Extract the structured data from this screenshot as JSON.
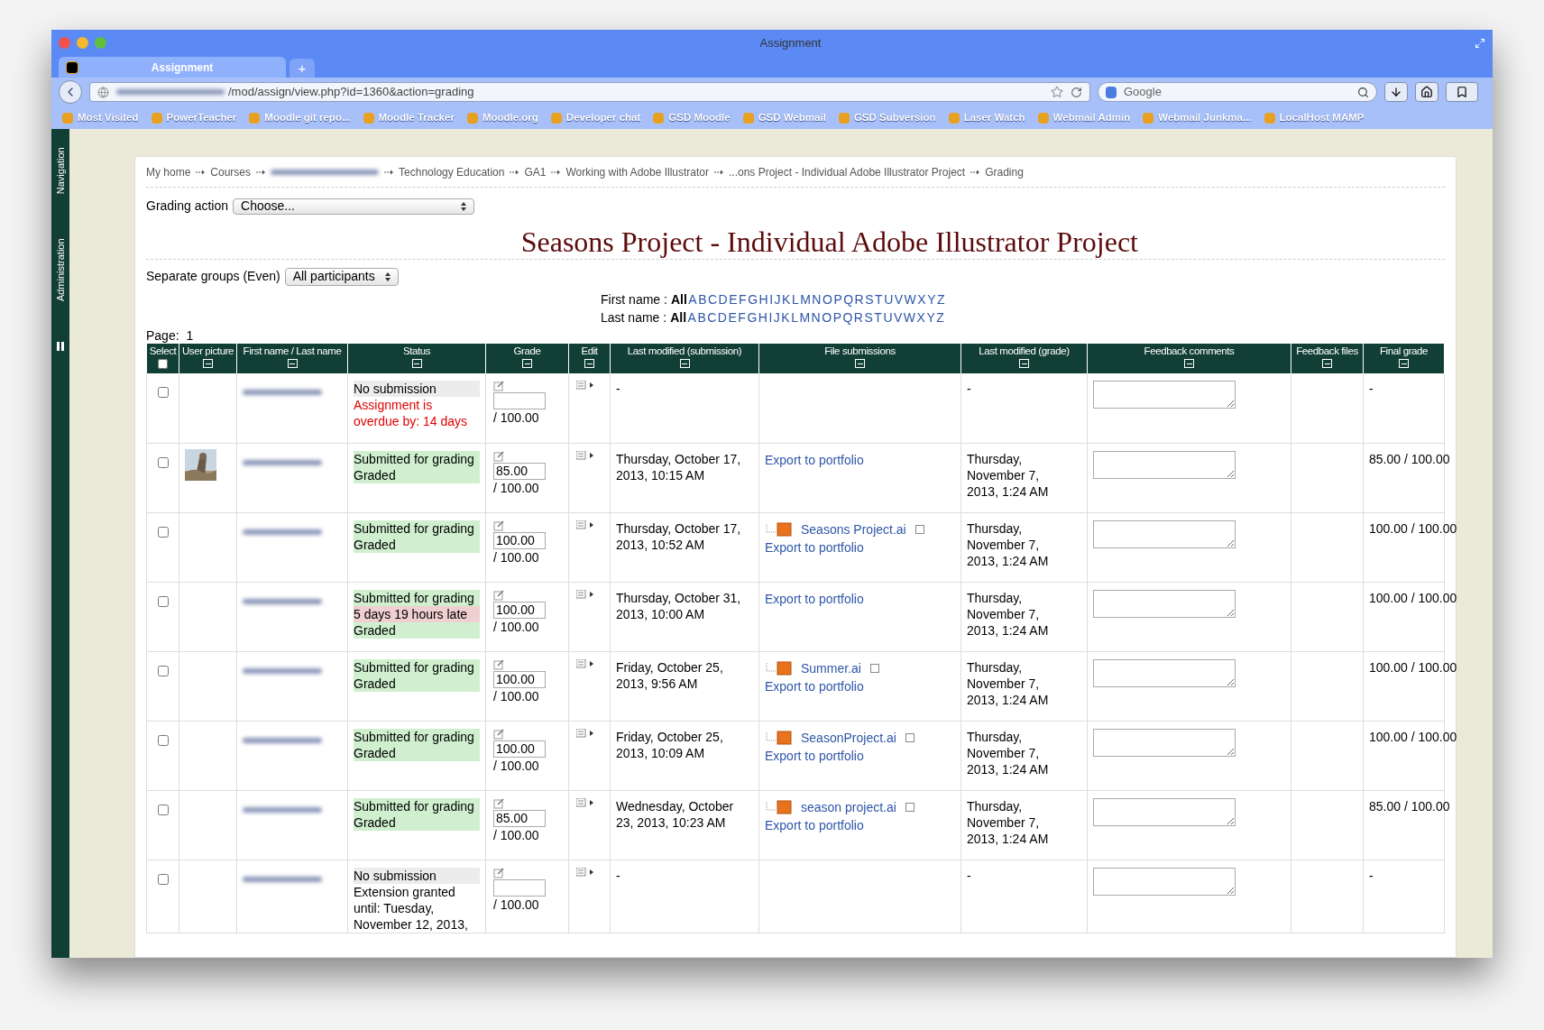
{
  "window": {
    "title": "Assignment"
  },
  "tabs": [
    {
      "label": "Assignment",
      "selected": true
    }
  ],
  "new_tab": "+",
  "address_bar": {
    "url": "/mod/assign/view.php?id=1360&action=grading"
  },
  "search": {
    "placeholder": "Google"
  },
  "bookmarks": [
    "Most Visited",
    "PowerTeacher",
    "Moodle git repo...",
    "Moodle Tracker",
    "Moodle.org",
    "Developer chat",
    "GSD Moodle",
    "GSD Webmail",
    "GSD Subversion",
    "Laser Watch",
    "Webmail Admin",
    "Webmail Junkma...",
    "LocalHost MAMP"
  ],
  "side_tabs": [
    "Navigation",
    "Administration"
  ],
  "breadcrumb": [
    {
      "kind": "link",
      "label": "My home"
    },
    {
      "kind": "link",
      "label": "Courses"
    },
    {
      "kind": "blurred"
    },
    {
      "kind": "link",
      "label": "Technology Education"
    },
    {
      "kind": "link",
      "label": "GA1"
    },
    {
      "kind": "link",
      "label": "Working with Adobe Illustrator"
    },
    {
      "kind": "link",
      "label": "...ons Project - Individual Adobe Illustrator Project"
    },
    {
      "kind": "link",
      "label": "Grading"
    }
  ],
  "grading_action": {
    "label": "Grading action",
    "value": "Choose..."
  },
  "title": "Seasons Project - Individual Adobe Illustrator Project",
  "groups": {
    "label": "Separate groups (Even)",
    "value": "All participants"
  },
  "initials": [
    {
      "label": "First name :",
      "letters": [
        {
          "label": "All",
          "selected": true
        },
        {
          "label": "A",
          "selected": false
        },
        {
          "label": "B",
          "selected": false
        },
        {
          "label": "C",
          "selected": false
        },
        {
          "label": "D",
          "selected": false
        },
        {
          "label": "E",
          "selected": false
        },
        {
          "label": "F",
          "selected": false
        },
        {
          "label": "G",
          "selected": false
        },
        {
          "label": "H",
          "selected": false
        },
        {
          "label": "I",
          "selected": false
        },
        {
          "label": "J",
          "selected": false
        },
        {
          "label": "K",
          "selected": false
        },
        {
          "label": "L",
          "selected": false
        },
        {
          "label": "M",
          "selected": false
        },
        {
          "label": "N",
          "selected": false
        },
        {
          "label": "O",
          "selected": false
        },
        {
          "label": "P",
          "selected": false
        },
        {
          "label": "Q",
          "selected": false
        },
        {
          "label": "R",
          "selected": false
        },
        {
          "label": "S",
          "selected": false
        },
        {
          "label": "T",
          "selected": false
        },
        {
          "label": "U",
          "selected": false
        },
        {
          "label": "V",
          "selected": false
        },
        {
          "label": "W",
          "selected": false
        },
        {
          "label": "X",
          "selected": false
        },
        {
          "label": "Y",
          "selected": false
        },
        {
          "label": "Z",
          "selected": false
        }
      ]
    },
    {
      "label": "Last name :",
      "letters": [
        {
          "label": "All",
          "selected": true
        },
        {
          "label": "A",
          "selected": false
        },
        {
          "label": "B",
          "selected": false
        },
        {
          "label": "C",
          "selected": false
        },
        {
          "label": "D",
          "selected": false
        },
        {
          "label": "E",
          "selected": false
        },
        {
          "label": "F",
          "selected": false
        },
        {
          "label": "G",
          "selected": false
        },
        {
          "label": "H",
          "selected": false
        },
        {
          "label": "I",
          "selected": false
        },
        {
          "label": "J",
          "selected": false
        },
        {
          "label": "K",
          "selected": false
        },
        {
          "label": "L",
          "selected": false
        },
        {
          "label": "M",
          "selected": false
        },
        {
          "label": "N",
          "selected": false
        },
        {
          "label": "O",
          "selected": false
        },
        {
          "label": "P",
          "selected": false
        },
        {
          "label": "Q",
          "selected": false
        },
        {
          "label": "R",
          "selected": false
        },
        {
          "label": "S",
          "selected": false
        },
        {
          "label": "T",
          "selected": false
        },
        {
          "label": "U",
          "selected": false
        },
        {
          "label": "V",
          "selected": false
        },
        {
          "label": "W",
          "selected": false
        },
        {
          "label": "X",
          "selected": false
        },
        {
          "label": "Y",
          "selected": false
        },
        {
          "label": "Z",
          "selected": false
        }
      ]
    }
  ],
  "page": {
    "label": "Page:",
    "number": "1"
  },
  "table": {
    "select_all_checked": false,
    "columns": [
      {
        "label": "Select",
        "kind": "checkbox"
      },
      {
        "label": "User picture",
        "kind": "collapse"
      },
      {
        "label": "First name / Last name",
        "kind": "collapse"
      },
      {
        "label": "Status",
        "kind": "collapse"
      },
      {
        "label": "Grade",
        "kind": "collapse"
      },
      {
        "label": "Edit",
        "kind": "collapse"
      },
      {
        "label": "Last modified (submission)",
        "kind": "collapse"
      },
      {
        "label": "File submissions",
        "kind": "collapse"
      },
      {
        "label": "Last modified (grade)",
        "kind": "collapse"
      },
      {
        "label": "Feedback comments",
        "kind": "collapse"
      },
      {
        "label": "Feedback files",
        "kind": "collapse"
      },
      {
        "label": "Final grade",
        "kind": "collapse"
      }
    ],
    "rows": [
      {
        "checked": false,
        "has_picture": false,
        "status": [
          {
            "text": "No submission",
            "kind": "neutral"
          },
          {
            "text": "Assignment is overdue by: 14 days",
            "kind": "alert"
          }
        ],
        "grade_max": "/ 100.00",
        "last_modified_submission": "-",
        "files": [],
        "last_modified_grade": "-",
        "final_grade": "-"
      },
      {
        "checked": false,
        "has_picture": true,
        "status": [
          {
            "text": "Submitted for grading",
            "kind": "ok"
          },
          {
            "text": "Graded",
            "kind": "ok"
          }
        ],
        "grade": "85.00",
        "grade_max": "/ 100.00",
        "last_modified_submission": "Thursday, October 17, 2013, 10:15 AM",
        "files": [],
        "export": "Export to portfolio",
        "last_modified_grade": "Thursday, November 7, 2013, 1:24 AM",
        "final_grade": "85.00 / 100.00"
      },
      {
        "checked": false,
        "has_picture": false,
        "status": [
          {
            "text": "Submitted for grading",
            "kind": "ok"
          },
          {
            "text": "Graded",
            "kind": "ok"
          }
        ],
        "grade": "100.00",
        "grade_max": "/ 100.00",
        "last_modified_submission": "Thursday, October 17, 2013, 10:52 AM",
        "files": [
          "Seasons Project.ai"
        ],
        "export": "Export to portfolio",
        "last_modified_grade": "Thursday, November 7, 2013, 1:24 AM",
        "final_grade": "100.00 / 100.00"
      },
      {
        "checked": false,
        "has_picture": false,
        "status": [
          {
            "text": "Submitted for grading",
            "kind": "ok"
          },
          {
            "text": "5 days 19 hours late",
            "kind": "late"
          },
          {
            "text": "Graded",
            "kind": "ok"
          }
        ],
        "grade": "100.00",
        "grade_max": "/ 100.00",
        "last_modified_submission": "Thursday, October 31, 2013, 10:00 AM",
        "files": [],
        "export": "Export to portfolio",
        "last_modified_grade": "Thursday, November 7, 2013, 1:24 AM",
        "final_grade": "100.00 / 100.00"
      },
      {
        "checked": false,
        "has_picture": false,
        "status": [
          {
            "text": "Submitted for grading",
            "kind": "ok"
          },
          {
            "text": "Graded",
            "kind": "ok"
          }
        ],
        "grade": "100.00",
        "grade_max": "/ 100.00",
        "last_modified_submission": "Friday, October 25, 2013, 9:56 AM",
        "files": [
          "Summer.ai"
        ],
        "export": "Export to portfolio",
        "last_modified_grade": "Thursday, November 7, 2013, 1:24 AM",
        "final_grade": "100.00 / 100.00"
      },
      {
        "checked": false,
        "has_picture": false,
        "status": [
          {
            "text": "Submitted for grading",
            "kind": "ok"
          },
          {
            "text": "Graded",
            "kind": "ok"
          }
        ],
        "grade": "100.00",
        "grade_max": "/ 100.00",
        "last_modified_submission": "Friday, October 25, 2013, 10:09 AM",
        "files": [
          "SeasonProject.ai"
        ],
        "export": "Export to portfolio",
        "last_modified_grade": "Thursday, November 7, 2013, 1:24 AM",
        "final_grade": "100.00 / 100.00"
      },
      {
        "checked": false,
        "has_picture": false,
        "status": [
          {
            "text": "Submitted for grading",
            "kind": "ok"
          },
          {
            "text": "Graded",
            "kind": "ok"
          }
        ],
        "grade": "85.00",
        "grade_max": "/ 100.00",
        "last_modified_submission": "Wednesday, October 23, 2013, 10:23 AM",
        "files": [
          "season project.ai"
        ],
        "export": "Export to portfolio",
        "last_modified_grade": "Thursday, November 7, 2013, 1:24 AM",
        "final_grade": "85.00 / 100.00"
      },
      {
        "checked": false,
        "has_picture": false,
        "status": [
          {
            "text": "No submission",
            "kind": "neutral"
          },
          {
            "text": "Extension granted until: Tuesday, November 12, 2013,",
            "kind": "note"
          }
        ],
        "grade_max": "/ 100.00",
        "last_modified_submission": "-",
        "files": [],
        "last_modified_grade": "-",
        "final_grade": "-"
      }
    ]
  }
}
